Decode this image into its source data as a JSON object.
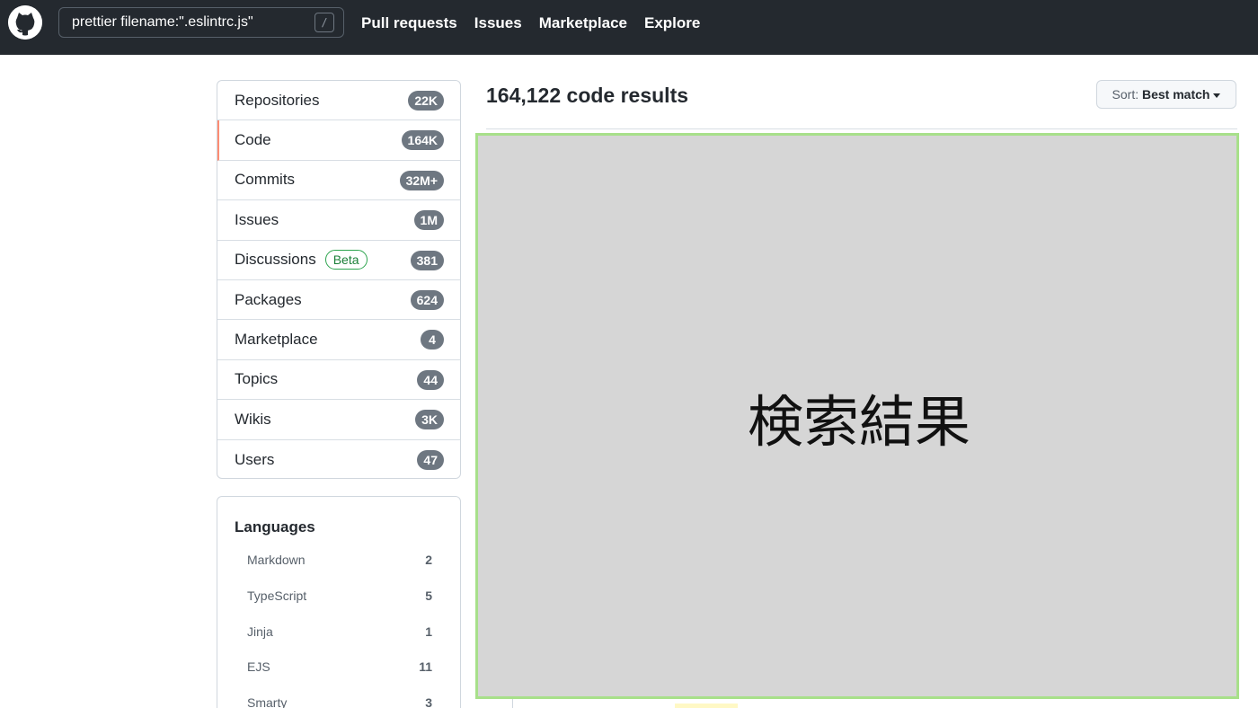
{
  "header": {
    "search_value": "prettier filename:\".eslintrc.js\"",
    "slash_hint": "/",
    "nav": [
      "Pull requests",
      "Issues",
      "Marketplace",
      "Explore"
    ]
  },
  "facets": [
    {
      "label": "Repositories",
      "count": "22K"
    },
    {
      "label": "Code",
      "count": "164K",
      "selected": true
    },
    {
      "label": "Commits",
      "count": "32M+"
    },
    {
      "label": "Issues",
      "count": "1M"
    },
    {
      "label": "Discussions",
      "badge": "Beta",
      "count": "381"
    },
    {
      "label": "Packages",
      "count": "624"
    },
    {
      "label": "Marketplace",
      "count": "4"
    },
    {
      "label": "Topics",
      "count": "44"
    },
    {
      "label": "Wikis",
      "count": "3K"
    },
    {
      "label": "Users",
      "count": "47"
    }
  ],
  "languages": {
    "title": "Languages",
    "items": [
      {
        "name": "Markdown",
        "count": "2"
      },
      {
        "name": "TypeScript",
        "count": "5"
      },
      {
        "name": "Jinja",
        "count": "1"
      },
      {
        "name": "EJS",
        "count": "11"
      },
      {
        "name": "Smarty",
        "count": "3"
      }
    ]
  },
  "results": {
    "title": "164,122 code results",
    "sort_prefix": "Sort:",
    "sort_value": "Best match"
  },
  "placeholder_text": "検索結果",
  "colors": {
    "header_bg": "#24292f",
    "selected_accent": "#fd8c73",
    "counter_bg": "#6e7781",
    "beta_green": "#1a7f37",
    "placeholder_bg": "#d6d6d6",
    "placeholder_border": "#a8e08a"
  }
}
